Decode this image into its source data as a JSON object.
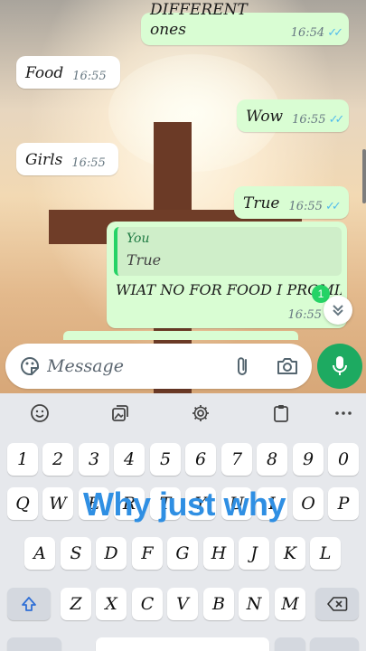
{
  "messages": [
    {
      "dir": "out",
      "text": "DIFFERENT  ones",
      "time": "16:54",
      "ticks": "read"
    },
    {
      "dir": "in",
      "text": "Food",
      "time": "16:55"
    },
    {
      "dir": "out",
      "text": "Wow",
      "time": "16:55",
      "ticks": "read"
    },
    {
      "dir": "in",
      "text": "Girls",
      "time": "16:55"
    },
    {
      "dir": "out",
      "text": "True",
      "time": "16:55",
      "ticks": "read"
    }
  ],
  "reply": {
    "quote_author": "You",
    "quote_text": "True",
    "text": "WIAT NO FOR FOOD I PROMIIE",
    "time": "16:55"
  },
  "unread_count": "1",
  "input": {
    "placeholder": "Message"
  },
  "icons": {
    "emoji": "sticker-icon",
    "attach": "paperclip-icon",
    "camera": "camera-icon",
    "mic": "microphone-icon",
    "scroll": "chevron-double-down-icon"
  },
  "keyboard": {
    "toolbar": [
      "emoji-icon",
      "image-sticker-icon",
      "settings-icon",
      "clipboard-icon",
      "more-icon"
    ],
    "row1": [
      "1",
      "2",
      "3",
      "4",
      "5",
      "6",
      "7",
      "8",
      "9",
      "0"
    ],
    "row2": [
      "Q",
      "W",
      "E",
      "R",
      "T",
      "Y",
      "U",
      "I",
      "O",
      "P"
    ],
    "row3": [
      "A",
      "S",
      "D",
      "F",
      "G",
      "H",
      "J",
      "K",
      "L"
    ],
    "row4": [
      "Z",
      "X",
      "C",
      "V",
      "B",
      "N",
      "M"
    ]
  },
  "overlay_caption": "Why just why",
  "colors": {
    "accent": "#1daa61",
    "outgoing": "#d9fdd3",
    "read_tick": "#53bdeb",
    "caption": "#2f8fe3"
  }
}
